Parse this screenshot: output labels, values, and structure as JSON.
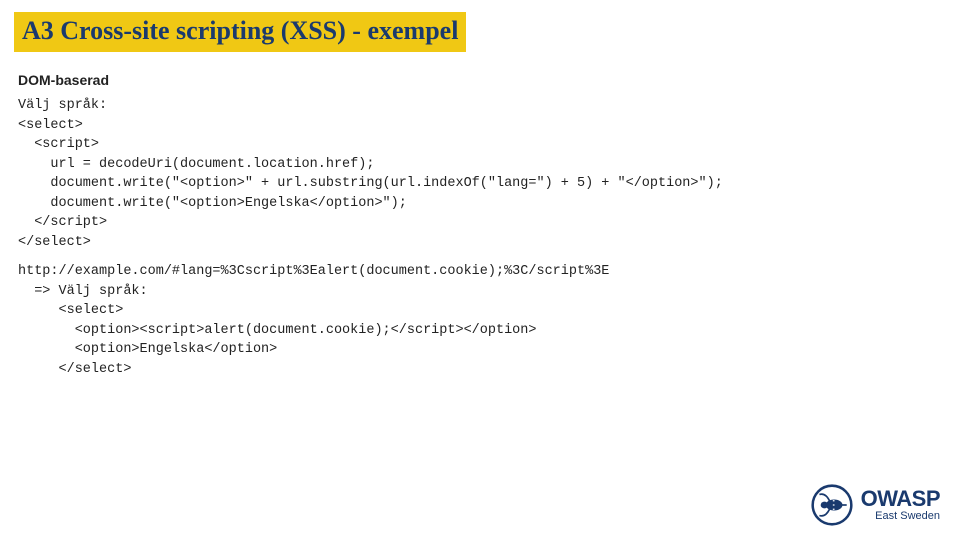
{
  "title": "A3 Cross-site scripting (XSS) - exempel",
  "subheading": "DOM-baserad",
  "code_block_1": "Välj språk:\n<select>\n  <script>\n    url = decodeUri(document.location.href);\n    document.write(\"<option>\" + url.substring(url.indexOf(\"lang=\") + 5) + \"</option>\");\n    document.write(\"<option>Engelska</option>\");\n  </script>\n</select>",
  "code_block_2": "http://example.com/#lang=%3Cscript%3Ealert(document.cookie);%3C/script%3E\n  => Välj språk:\n     <select>\n       <option><script>alert(document.cookie);</script></option>\n       <option>Engelska</option>\n     </select>",
  "logo": {
    "main": "OWASP",
    "sub": "East Sweden"
  }
}
